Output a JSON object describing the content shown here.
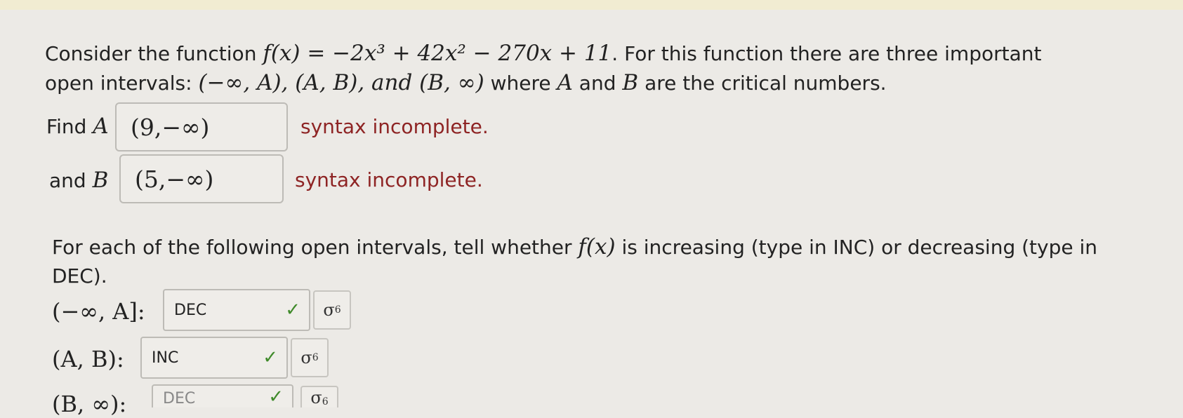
{
  "question": {
    "intro_text": "Consider the function",
    "function_expr": "f(x) = −2x³ + 42x² − 270x + 11",
    "intro_tail": ". For this function there are three important",
    "line2_text": "open intervals:",
    "intervals_text": "(−∞, A), (A, B), and (B, ∞)",
    "line2_tail_1": "where",
    "line2_A": "A",
    "line2_and": "and",
    "line2_B": "B",
    "line2_tail_2": "are the critical numbers."
  },
  "find_a": {
    "label": "Find",
    "var": "A",
    "value": "(9,−∞)",
    "message": "syntax incomplete."
  },
  "find_b": {
    "label": "and",
    "var": "B",
    "value": "(5,−∞)",
    "message": "syntax incomplete."
  },
  "part2": {
    "line1": "For each of the following open intervals, tell whether",
    "fx": "f(x)",
    "line1_tail": "is increasing (type in INC) or decreasing (type in",
    "line2": "DEC)."
  },
  "rows": [
    {
      "interval": "(−∞, A]:",
      "value": "DEC",
      "check": "✓",
      "icon": "σ"
    },
    {
      "interval": "(A, B):",
      "value": "INC",
      "check": "✓",
      "icon": "σ"
    },
    {
      "interval": "(B, ∞):",
      "value": "DEC",
      "check": "✓",
      "icon": "σ"
    }
  ],
  "colors": {
    "error": "#8e2424",
    "check": "#3f8a2a",
    "background": "#eceae6"
  }
}
